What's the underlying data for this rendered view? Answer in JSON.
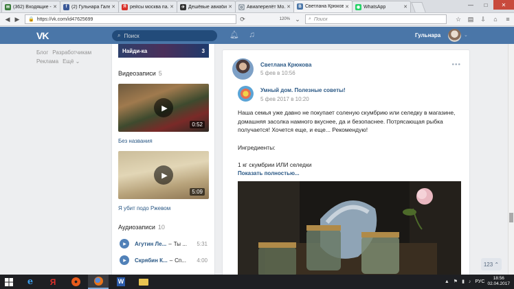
{
  "browser": {
    "tabs": [
      {
        "label": "(362) Входящие - ...",
        "color": "#3b7d3a",
        "glyph": "✉"
      },
      {
        "label": "(2) Гульнара Гале...",
        "color": "#3b5998",
        "glyph": "f"
      },
      {
        "label": "рейсы москва па...",
        "color": "#d9322b",
        "glyph": "Я"
      },
      {
        "label": "Дешёвые авиаби...",
        "color": "#333333",
        "glyph": "✈"
      },
      {
        "label": "Авиаперелёт Мо...",
        "color": "#9aa4ad",
        "glyph": "◯"
      },
      {
        "label": "Светлана Крюкова",
        "color": "#4a76a8",
        "glyph": "B"
      },
      {
        "label": "WhatsApp",
        "color": "#25d366",
        "glyph": "◉"
      }
    ],
    "url": "https://vk.com/id47625699",
    "zoom": "120%",
    "search_placeholder": "Поиск",
    "close_glyph": "✕"
  },
  "vk": {
    "logo": "VK",
    "search_placeholder": "Поиск",
    "user_name": "Гульнара",
    "left_links": {
      "blog": "Блог",
      "devs": "Разработчикам",
      "ads": "Реклама",
      "more": "Ещё ⌄"
    },
    "card_title": "Найди-ка",
    "card_count": "3",
    "videos": {
      "heading": "Видеозаписи",
      "count": "5",
      "items": [
        {
          "title": "Без названия",
          "duration": "0:52"
        },
        {
          "title": "Я убит подо Ржевом",
          "duration": "5:09"
        }
      ]
    },
    "audios": {
      "heading": "Аудиозаписи",
      "count": "10",
      "items": [
        {
          "artist": "Агутин Ле...",
          "song": "Ты ...",
          "duration": "5:31"
        },
        {
          "artist": "Скрябин К...",
          "song": "Сп...",
          "duration": "4:00"
        }
      ]
    },
    "post": {
      "author": "Светлана Крюкова",
      "date": "5 фев в 10:56",
      "repost_author": "Умный дом. Полезные советы!",
      "repost_date": "5 фев 2017 в 10:20",
      "text_1": "Наша семья уже давно не покупает соленую скумбрию или селедку в магазине, домашняя засолка намного вкуснее, да и безопаснее. Потрясающая рыбка получается! Хочется еще, и еще... Рекомендую!",
      "text_2": "Ингредиенты:",
      "text_3": "1 кг скумбрии ИЛИ селедки",
      "show_more": "Показать полностью..."
    },
    "page_counter": "123 ⌃"
  },
  "taskbar": {
    "lang": "РУС",
    "time": "18:56",
    "date": "02.04.2017"
  }
}
